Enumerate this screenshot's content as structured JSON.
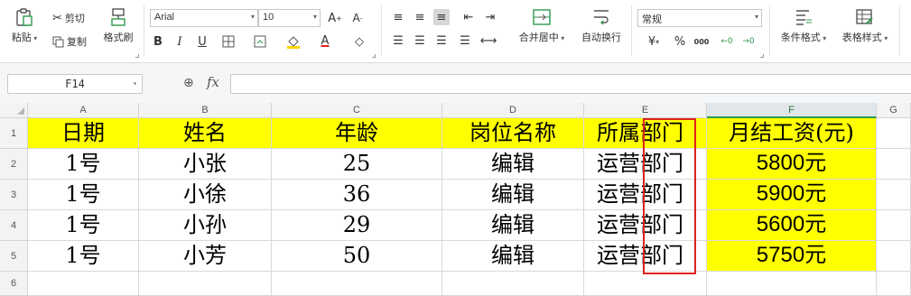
{
  "toolbar": {
    "paste_label": "粘贴",
    "cut_label": "剪切",
    "copy_label": "复制",
    "format_painter_label": "格式刷",
    "font_name": "Arial",
    "font_size": "10",
    "merge_center_label": "合并居中",
    "wrap_text_label": "自动换行",
    "number_format": "常规",
    "conditional_format_label": "条件格式",
    "table_style_label": "表格样式",
    "percent_symbol": "%",
    "thousands_symbol": "000"
  },
  "formula_bar": {
    "name_box": "F14",
    "fx_label": "fx",
    "formula": ""
  },
  "columns": [
    "A",
    "B",
    "C",
    "D",
    "E",
    "F",
    "G"
  ],
  "rows": [
    "1",
    "2",
    "3",
    "4",
    "5",
    "6"
  ],
  "cells": {
    "header": [
      "日期",
      "姓名",
      "年龄",
      "岗位名称",
      "所属部门",
      "月结工资(元)"
    ],
    "r2": [
      "1号",
      "小张",
      "25",
      "编辑",
      "运营部门",
      "5800元"
    ],
    "r3": [
      "1号",
      "小徐",
      "36",
      "编辑",
      "运营部门",
      "5900元"
    ],
    "r4": [
      "1号",
      "小孙",
      "29",
      "编辑",
      "运营部门",
      "5600元"
    ],
    "r5": [
      "1号",
      "小芳",
      "50",
      "编辑",
      "运营部门",
      "5750元"
    ]
  },
  "colors": {
    "highlight": "#ffff00",
    "annotation_box": "#e0211d",
    "selected_column_accent": "#2e9a4d"
  }
}
